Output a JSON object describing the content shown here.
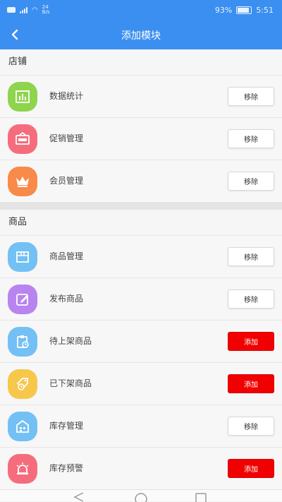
{
  "status_bar": {
    "network": "24\nB/s",
    "battery": "93%",
    "time": "5:51"
  },
  "header": {
    "title": "添加模块"
  },
  "sections": [
    {
      "title": "店铺",
      "items": [
        {
          "label": "数据统计",
          "icon": "bar-chart-icon",
          "color": "#8ed44c",
          "action": "移除"
        },
        {
          "label": "促销管理",
          "icon": "sale-tag-icon",
          "color": "#f56d7d",
          "action": "移除"
        },
        {
          "label": "会员管理",
          "icon": "crown-icon",
          "color": "#f88a4a",
          "action": "移除"
        }
      ]
    },
    {
      "title": "商品",
      "items": [
        {
          "label": "商品管理",
          "icon": "box-icon",
          "color": "#73c0f5",
          "action": "移除"
        },
        {
          "label": "发布商品",
          "icon": "edit-icon",
          "color": "#b884f0",
          "action": "移除"
        },
        {
          "label": "待上架商品",
          "icon": "clipboard-clock-icon",
          "color": "#73c0f5",
          "action": "添加"
        },
        {
          "label": "已下架商品",
          "icon": "tag-clock-icon",
          "color": "#f6c74a",
          "action": "添加"
        },
        {
          "label": "库存管理",
          "icon": "warehouse-icon",
          "color": "#73c0f5",
          "action": "移除"
        },
        {
          "label": "库存预警",
          "icon": "alarm-icon",
          "color": "#f56d7d",
          "action": "添加"
        }
      ]
    }
  ]
}
